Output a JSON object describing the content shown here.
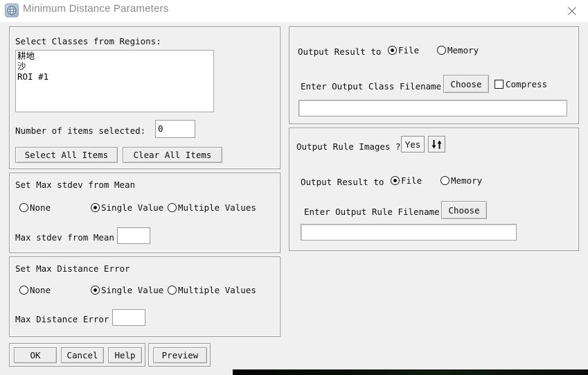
{
  "window": {
    "title": "Minimum Distance Parameters",
    "icon": "envi-globe-icon",
    "close_label": "close-icon"
  },
  "left": {
    "classes_panel": {
      "label": "Select Classes from Regions:",
      "items": [
        "耕地",
        "沙",
        "ROI #1"
      ],
      "count_label": "Number of items selected:",
      "count_value": "0",
      "select_all_label": "Select All Items",
      "clear_all_label": "Clear All Items"
    },
    "stdev_panel": {
      "title": "Set Max stdev from Mean",
      "options": [
        "None",
        "Single Value",
        "Multiple Values"
      ],
      "selected": "Single Value",
      "field_label": "Max stdev from Mean",
      "field_value": ""
    },
    "distance_panel": {
      "title": "Set Max Distance Error",
      "options": [
        "None",
        "Single Value",
        "Multiple Values"
      ],
      "selected": "Single Value",
      "field_label": "Max Distance Error",
      "field_value": ""
    }
  },
  "footer": {
    "ok_label": "OK",
    "cancel_label": "Cancel",
    "help_label": "Help",
    "preview_label": "Preview"
  },
  "right": {
    "class_output_panel": {
      "output_to_label": "Output Result to",
      "options": [
        "File",
        "Memory"
      ],
      "selected": "File",
      "filename_label": "Enter Output Class Filename",
      "choose_label": "Choose",
      "compress_label": "Compress",
      "compress_checked": false,
      "filename_value": ""
    },
    "rule_output_panel": {
      "rule_question_label": "Output Rule Images ?",
      "rule_toggle_value": "Yes",
      "toggle_icon": "up-down-arrow-icon",
      "output_to_label": "Output Result to",
      "options": [
        "File",
        "Memory"
      ],
      "selected": "File",
      "filename_label": "Enter Output Rule Filename",
      "choose_label": "Choose",
      "filename_value": ""
    }
  },
  "colors": {
    "dialog_bg": "#f0f0f0",
    "panel_border": "#9a9a9a",
    "field_bg": "#ffffff",
    "title_text": "#8a8a8a"
  }
}
